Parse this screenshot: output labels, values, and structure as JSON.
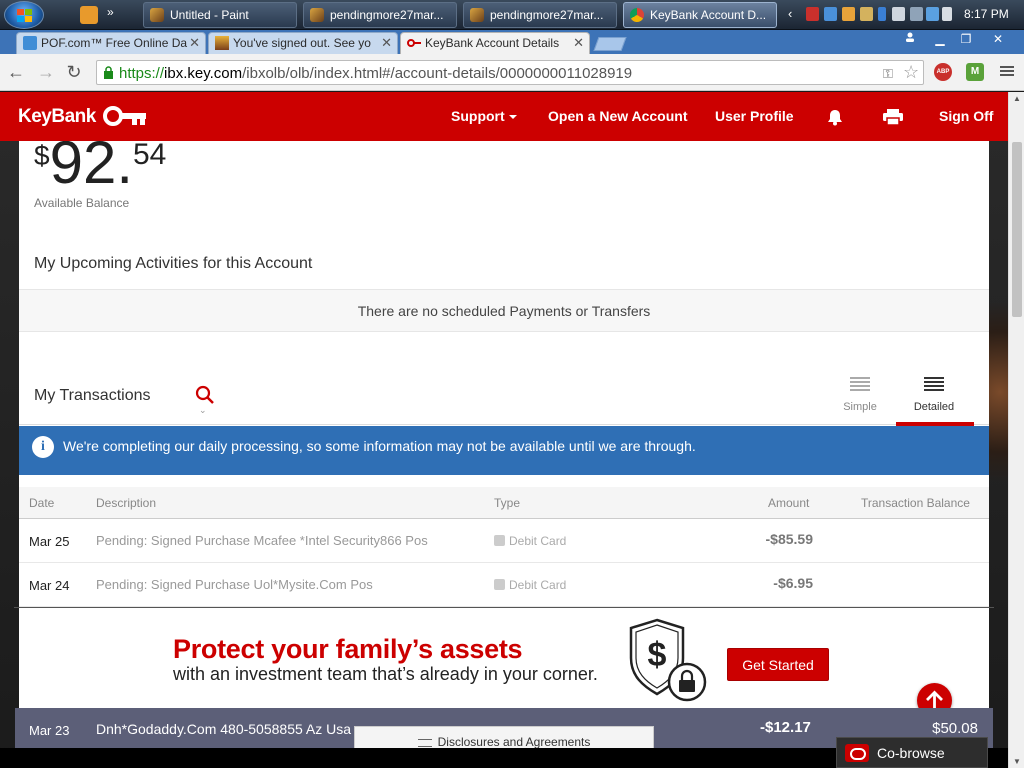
{
  "taskbar": {
    "tasks": [
      {
        "label": "Untitled - Paint",
        "active": false
      },
      {
        "label": "pendingmore27mar...",
        "active": false
      },
      {
        "label": "pendingmore27mar...",
        "active": false
      },
      {
        "label": "KeyBank Account D...",
        "active": true
      }
    ],
    "clock": "8:17 PM"
  },
  "browser": {
    "tabs": [
      {
        "label": "POF.com™ Free Online Da",
        "active": false
      },
      {
        "label": "You've signed out. See yo",
        "active": false
      },
      {
        "label": "KeyBank Account Details",
        "active": true
      }
    ],
    "url": {
      "scheme": "https://",
      "host": "ibx.key.com",
      "path": "/ibxolb/olb/index.html#/account-details/0000000011028919"
    },
    "extensions": [
      "ABP",
      "M"
    ]
  },
  "header": {
    "logo": "KeyBank",
    "nav": {
      "support": "Support",
      "open_account": "Open a New Account",
      "user_profile": "User Profile",
      "sign_off": "Sign Off"
    }
  },
  "account": {
    "balance_symbol": "$",
    "balance_whole": "92.",
    "balance_cents": "54",
    "balance_label": "Available Balance"
  },
  "upcoming": {
    "title": "My Upcoming Activities for this Account",
    "empty_message": "There are no scheduled Payments or Transfers"
  },
  "transactions": {
    "title": "My Transactions",
    "views": {
      "simple": "Simple",
      "detailed": "Detailed",
      "selected": "Detailed"
    },
    "notice": "We're completing our daily processing, so some information may not be available until we are through.",
    "columns": {
      "date": "Date",
      "description": "Description",
      "type": "Type",
      "amount": "Amount",
      "balance": "Transaction Balance"
    },
    "rows": [
      {
        "date": "Mar 25",
        "description": "Pending: Signed Purchase Mcafee *Intel Security866 Pos",
        "type": "Debit Card",
        "amount": "-$85.59"
      },
      {
        "date": "Mar 24",
        "description": "Pending: Signed Purchase Uol*Mysite.Com Pos",
        "type": "Debit Card",
        "amount": "-$6.95"
      }
    ],
    "visible_last_row": {
      "date": "Mar 23",
      "description": "Dnh*Godaddy.Com 480-5058855 Az Usa",
      "amount": "-$12.17",
      "balance": "$50.08"
    }
  },
  "promo": {
    "headline": "Protect your family’s assets",
    "subline": "with an investment team that’s already in your corner.",
    "cta": "Get Started"
  },
  "footer": {
    "disclosures": "Disclosures and Agreements",
    "cobrowse": "Co-browse"
  },
  "colors": {
    "brand_red": "#cc0000",
    "notice_blue": "#2f6fb5",
    "tabstrip_blue": "#3d73b7"
  }
}
